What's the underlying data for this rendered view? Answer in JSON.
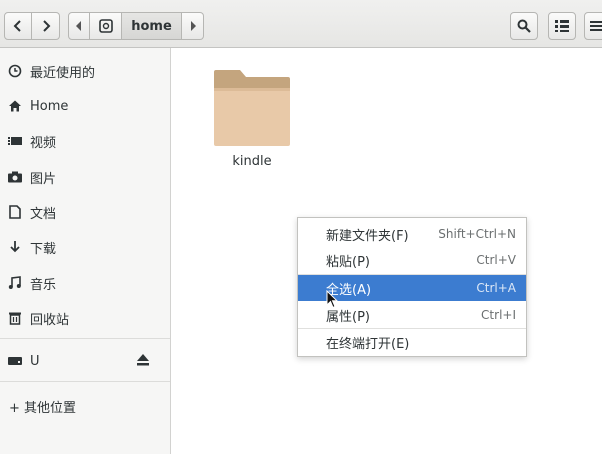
{
  "header": {
    "path_current": "home"
  },
  "sidebar": {
    "items": [
      {
        "label": "最近使用的",
        "icon": "clock-icon"
      },
      {
        "label": "Home",
        "icon": "home-icon"
      },
      {
        "label": "视频",
        "icon": "video-icon"
      },
      {
        "label": "图片",
        "icon": "camera-icon"
      },
      {
        "label": "文档",
        "icon": "document-icon"
      },
      {
        "label": "下载",
        "icon": "download-icon"
      },
      {
        "label": "音乐",
        "icon": "music-icon"
      },
      {
        "label": "回收站",
        "icon": "trash-icon"
      }
    ],
    "device": {
      "label": "U",
      "icon": "drive-icon",
      "eject_icon": "eject-icon"
    },
    "other": {
      "label": "+ 其他位置"
    }
  },
  "content": {
    "folders": [
      {
        "name": "kindle"
      }
    ]
  },
  "context_menu": {
    "items": [
      {
        "label": "新建文件夹(F)",
        "shortcut": "Shift+Ctrl+N"
      },
      {
        "label": "粘贴(P)",
        "shortcut": "Ctrl+V"
      },
      {
        "label": "全选(A)",
        "shortcut": "Ctrl+A",
        "highlighted": true
      },
      {
        "label": "属性(P)",
        "shortcut": "Ctrl+I"
      },
      {
        "label": "在终端打开(E)",
        "shortcut": ""
      }
    ]
  },
  "colors": {
    "menu_highlight": "#3c7cd0",
    "folder_body": "#e8c9a8",
    "folder_tab": "#c4a57e"
  }
}
